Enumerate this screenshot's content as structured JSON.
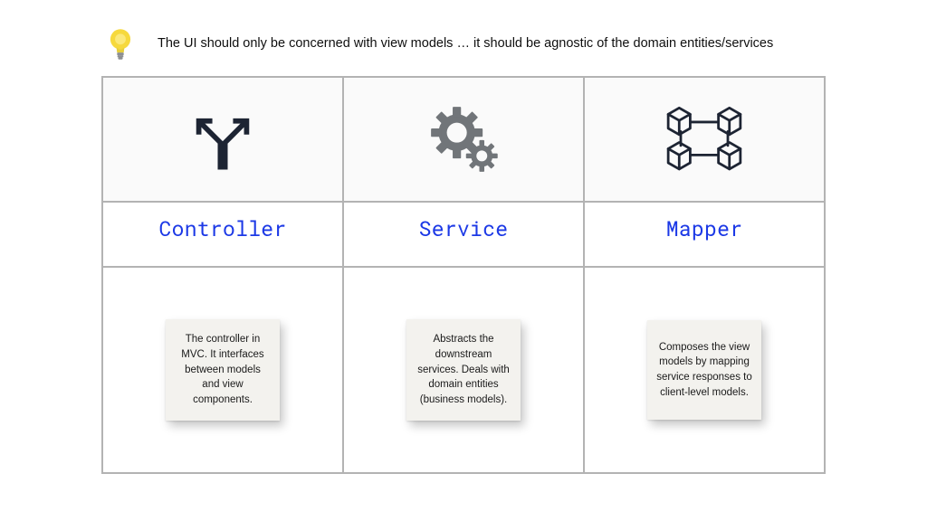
{
  "hint": "The UI should only be concerned with view models … it should be agnostic of the domain entities/services",
  "columns": [
    {
      "title": "Controller",
      "icon": "split-arrows-icon",
      "description": "The controller in MVC. It interfaces between models and view components."
    },
    {
      "title": "Service",
      "icon": "gears-icon",
      "description": "Abstracts the downstream services. Deals with domain entities (business models)."
    },
    {
      "title": "Mapper",
      "icon": "cubes-network-icon",
      "description": "Composes the view models by mapping service responses to client-level models."
    }
  ]
}
